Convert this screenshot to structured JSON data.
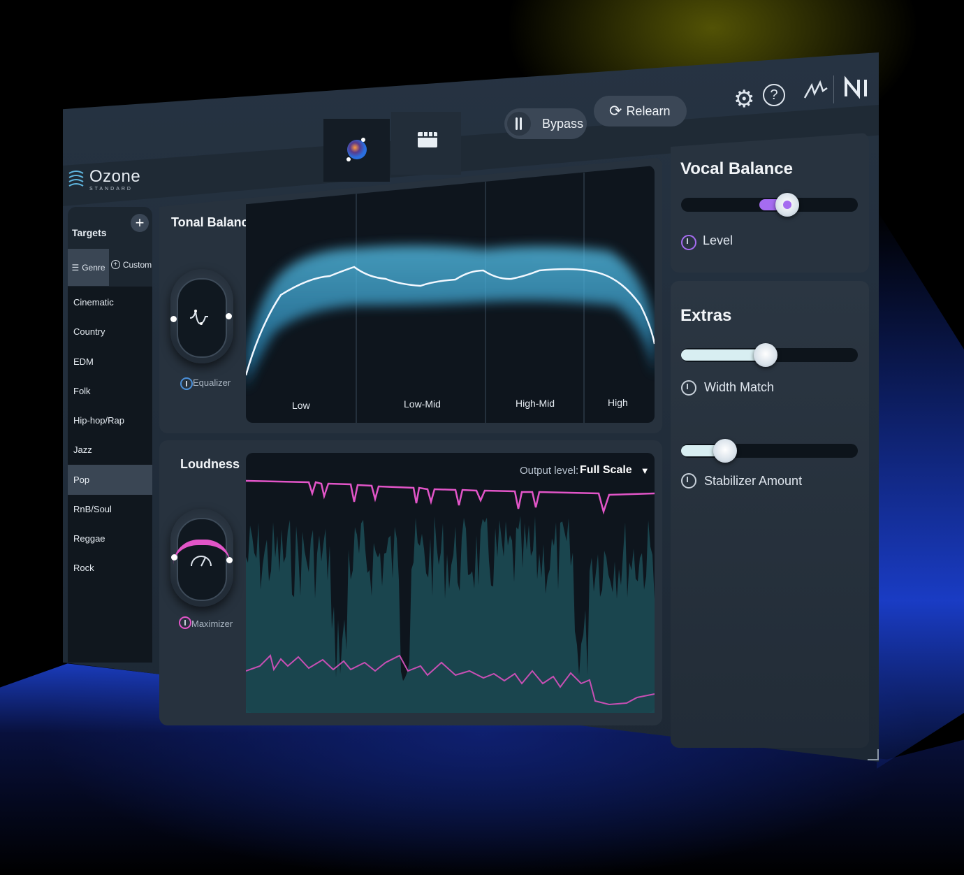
{
  "app": {
    "name": "Ozone",
    "edition": "STANDARD"
  },
  "header": {
    "bypass_label": "Bypass",
    "relearn_label": "Relearn",
    "icons": [
      "settings-gear-icon",
      "help-icon",
      "signature-icon",
      "ni-logo-icon"
    ]
  },
  "targets": {
    "title": "Targets",
    "tabs": [
      {
        "label": "Genre",
        "selected": true
      },
      {
        "label": "Custom",
        "selected": false
      }
    ],
    "genres": [
      "Cinematic",
      "Country",
      "EDM",
      "Folk",
      "Hip-hop/Rap",
      "Jazz",
      "Pop",
      "RnB/Soul",
      "Reggae",
      "Rock"
    ],
    "selected_genre": "Pop"
  },
  "tonal_balance": {
    "title": "Tonal Balance",
    "module_label": "Equalizer",
    "bands": [
      "Low",
      "Low-Mid",
      "High-Mid",
      "High"
    ]
  },
  "loudness": {
    "title": "Loudness",
    "module_label": "Maximizer",
    "output_label": "Output level:",
    "output_value": "Full Scale"
  },
  "vocal_balance": {
    "title": "Vocal Balance",
    "level_label": "Level",
    "level_fraction": 0.6
  },
  "extras": {
    "title": "Extras",
    "sliders": [
      {
        "label": "Width Match",
        "fraction": 0.48
      },
      {
        "label": "Stabilizer Amount",
        "fraction": 0.25
      }
    ]
  },
  "colors": {
    "accent_blue": "#5fd3ff",
    "accent_magenta": "#e255c8",
    "accent_purple": "#a56cf0",
    "panel": "#27323e",
    "background": "#000000"
  }
}
